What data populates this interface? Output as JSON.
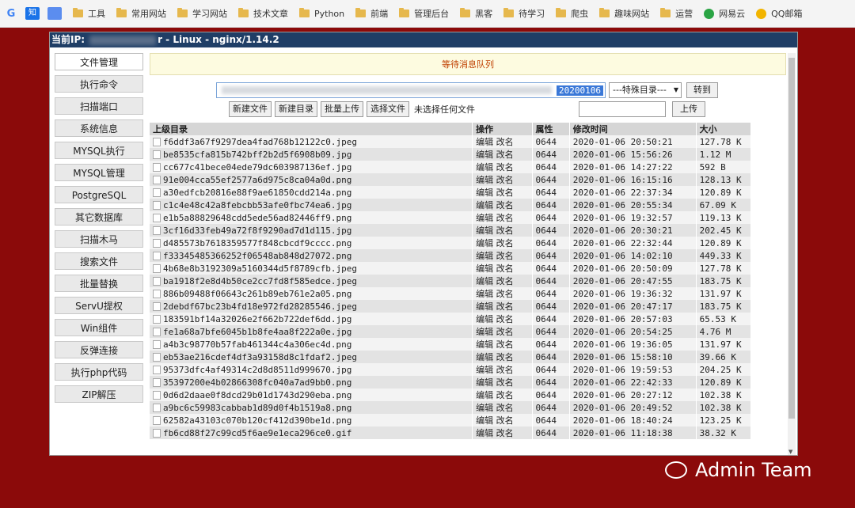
{
  "bookmarks": [
    "工具",
    "常用网站",
    "学习网站",
    "技术文章",
    "Python",
    "前端",
    "管理后台",
    "黑客",
    "待学习",
    "爬虫",
    "趣味网站",
    "运营",
    "网易云",
    "QQ邮箱"
  ],
  "bookmark_icons": {
    "g": "G",
    "zhi": "知"
  },
  "titlebar": {
    "prefix": "当前IP:",
    "suffix": "r - Linux - nginx/1.14.2"
  },
  "sidebar": [
    "文件管理",
    "执行命令",
    "扫描端口",
    "系统信息",
    "MYSQL执行",
    "MYSQL管理",
    "PostgreSQL",
    "其它数据库",
    "扫描木马",
    "搜索文件",
    "批量替换",
    "ServU提权",
    "Win组件",
    "反弹连接",
    "执行php代码",
    "ZIP解压"
  ],
  "notice": "等待消息队列",
  "path": {
    "visible_tail": "20200106",
    "special_dir": "---特殊目录---",
    "goto_label": "转到"
  },
  "buttons": {
    "new_file": "新建文件",
    "new_dir": "新建目录",
    "batch_upload": "批量上传",
    "choose_file": "选择文件",
    "no_file": "未选择任何文件",
    "upload": "上传"
  },
  "table": {
    "headers": [
      "上级目录",
      "操作",
      "属性",
      "修改时间",
      "大小"
    ],
    "action_edit": "编辑",
    "action_rename": "改名",
    "rows": [
      [
        "f6ddf3a67f9297dea4fad768b12122c0.jpeg",
        "0644",
        "2020-01-06 20:50:21",
        "127.78 K"
      ],
      [
        "be8535cfa815b742bff2b2d5f6908b09.jpg",
        "0644",
        "2020-01-06 15:56:26",
        "1.12 M"
      ],
      [
        "cc677c41bece04ede79dc603987136ef.jpg",
        "0644",
        "2020-01-06 14:27:22",
        "592 B"
      ],
      [
        "91e004cca55ef2577a6d975c8ca04a0d.png",
        "0644",
        "2020-01-06 16:15:16",
        "128.13 K"
      ],
      [
        "a30edfcb20816e88f9ae61850cdd214a.png",
        "0644",
        "2020-01-06 22:37:34",
        "120.89 K"
      ],
      [
        "c1c4e48c42a8febcbb53afe0fbc74ea6.jpg",
        "0644",
        "2020-01-06 20:55:34",
        "67.09 K"
      ],
      [
        "e1b5a88829648cdd5ede56ad82446ff9.png",
        "0644",
        "2020-01-06 19:32:57",
        "119.13 K"
      ],
      [
        "3cf16d33feb49a72f8f9290ad7d1d115.jpg",
        "0644",
        "2020-01-06 20:30:21",
        "202.45 K"
      ],
      [
        "d485573b7618359577f848cbcdf9cccc.png",
        "0644",
        "2020-01-06 22:32:44",
        "120.89 K"
      ],
      [
        "f33345485366252f06548ab848d27072.png",
        "0644",
        "2020-01-06 14:02:10",
        "449.33 K"
      ],
      [
        "4b68e8b3192309a5160344d5f8789cfb.jpeg",
        "0644",
        "2020-01-06 20:50:09",
        "127.78 K"
      ],
      [
        "ba1918f2e8d4b50ce2cc7fd8f585edce.jpeg",
        "0644",
        "2020-01-06 20:47:55",
        "183.75 K"
      ],
      [
        "886b09488f06643c261b89eb761e2a05.png",
        "0644",
        "2020-01-06 19:36:32",
        "131.97 K"
      ],
      [
        "2debdf67bc23b4fd18e972fd28285546.jpeg",
        "0644",
        "2020-01-06 20:47:17",
        "183.75 K"
      ],
      [
        "183591bf14a32026e2f662b722def6dd.jpg",
        "0644",
        "2020-01-06 20:57:03",
        "65.53 K"
      ],
      [
        "fe1a68a7bfe6045b1b8fe4aa8f222a0e.jpg",
        "0644",
        "2020-01-06 20:54:25",
        "4.76 M"
      ],
      [
        "a4b3c98770b57fab461344c4a306ec4d.png",
        "0644",
        "2020-01-06 19:36:05",
        "131.97 K"
      ],
      [
        "eb53ae216cdef4df3a93158d8c1fdaf2.jpeg",
        "0644",
        "2020-01-06 15:58:10",
        "39.66 K"
      ],
      [
        "95373dfc4af49314c2d8d8511d999670.jpg",
        "0644",
        "2020-01-06 19:59:53",
        "204.25 K"
      ],
      [
        "35397200e4b02866308fc040a7ad9bb0.png",
        "0644",
        "2020-01-06 22:42:33",
        "120.89 K"
      ],
      [
        "0d6d2daae0f8dcd29b01d1743d290eba.png",
        "0644",
        "2020-01-06 20:27:12",
        "102.38 K"
      ],
      [
        "a9bc6c59983cabbab1d89d0f4b1519a8.png",
        "0644",
        "2020-01-06 20:49:52",
        "102.38 K"
      ],
      [
        "62582a43103c070b120cf412d390be1d.png",
        "0644",
        "2020-01-06 18:40:24",
        "123.25 K"
      ],
      [
        "fb6cd88f27c99cd5f6ae9e1eca296ce0.gif",
        "0644",
        "2020-01-06 11:18:38",
        "38.32 K"
      ]
    ]
  },
  "watermark": "Admin Team"
}
